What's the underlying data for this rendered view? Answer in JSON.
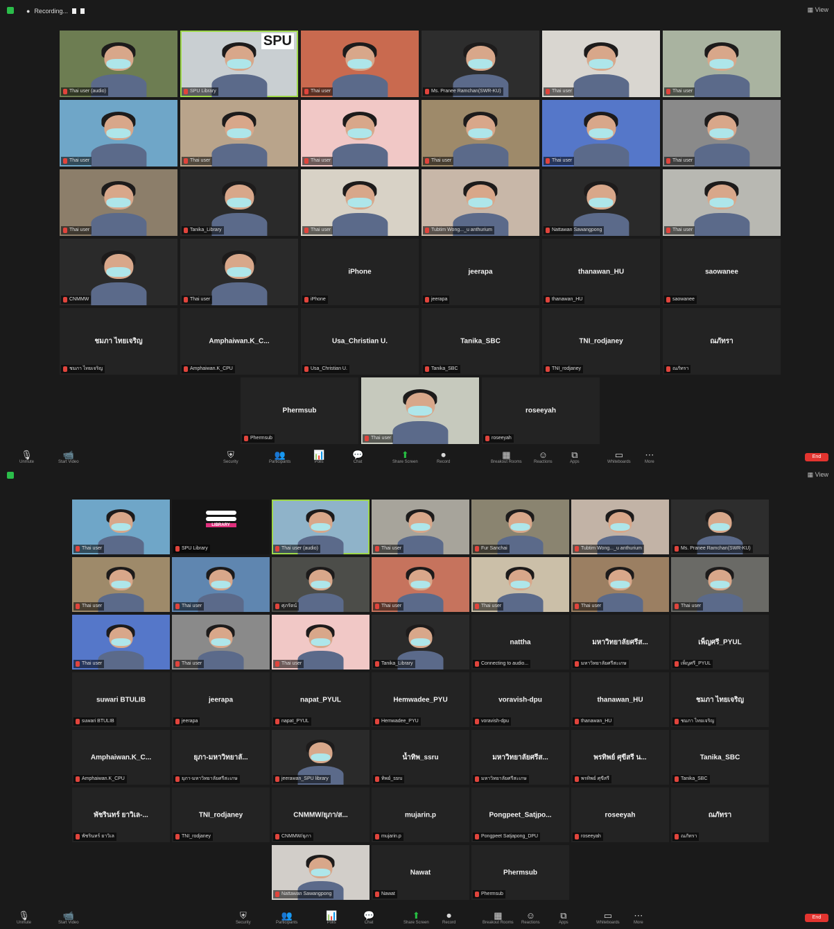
{
  "colors": {
    "background": "#1a1a1a",
    "tile": "#232323",
    "active_border": "#9ed84a",
    "end_button": "#e3342f",
    "share_green": "#27c043"
  },
  "window1": {
    "recording_label": "Recording...",
    "view_label": "View",
    "end_label": "End",
    "tiles": [
      {
        "kind": "video",
        "label": "Thai user (audio)",
        "bg": "#6d7d52"
      },
      {
        "kind": "video",
        "label": "SPU Library",
        "bg": "#c9cfd2",
        "logo": "SPU",
        "active": true
      },
      {
        "kind": "video",
        "label": "Thai user",
        "bg": "#c96a4f"
      },
      {
        "kind": "video",
        "label": "Ms. Pranee Ramchan(SWR-KU)",
        "bg": "#2d2d2d"
      },
      {
        "kind": "video",
        "label": "Thai user",
        "bg": "#d9d6d0"
      },
      {
        "kind": "video",
        "label": "Thai user",
        "bg": "#a9b3a0"
      },
      {
        "kind": "video",
        "label": "Thai user",
        "bg": "#6fa6c8"
      },
      {
        "kind": "video",
        "label": "Thai user",
        "bg": "#b9a48b"
      },
      {
        "kind": "video",
        "label": "Thai user",
        "bg": "#f1c8c6"
      },
      {
        "kind": "video",
        "label": "Thai user",
        "bg": "#9e8a6a"
      },
      {
        "kind": "video",
        "label": "Thai user",
        "bg": "#5577c9"
      },
      {
        "kind": "video",
        "label": "Thai user",
        "bg": "#8a8a8a"
      },
      {
        "kind": "video",
        "label": "Thai user",
        "bg": "#8c7e6a"
      },
      {
        "kind": "video",
        "label": "Tanika_Library",
        "bg": "#2a2a2a"
      },
      {
        "kind": "video",
        "label": "Thai user",
        "bg": "#d8d2c6"
      },
      {
        "kind": "video",
        "label": "Tubtim Wong..._u anthurium",
        "bg": "#c8b7a8"
      },
      {
        "kind": "video",
        "label": "Nattawan Sawangpong",
        "bg": "#2a2a2a"
      },
      {
        "kind": "video",
        "label": "Thai user",
        "bg": "#b8b8b2"
      },
      {
        "kind": "video",
        "label": "CNMMW",
        "bg": "#2a2a2a"
      },
      {
        "kind": "video",
        "label": "Thai user",
        "bg": "#2a2a2a"
      },
      {
        "kind": "name",
        "name": "iPhone",
        "label": "iPhone"
      },
      {
        "kind": "name",
        "name": "jeerapa",
        "label": "jeerapa"
      },
      {
        "kind": "name",
        "name": "thanawan_HU",
        "label": "thanawan_HU"
      },
      {
        "kind": "name",
        "name": "saowanee",
        "label": "saowanee"
      },
      {
        "kind": "name",
        "name": "ชมภา ไทยเจริญ",
        "label": "ชมภา ไทยเจริญ"
      },
      {
        "kind": "name",
        "name": "Amphaiwan.K_C...",
        "label": "Amphaiwan.K_CPU"
      },
      {
        "kind": "name",
        "name": "Usa_Christian U.",
        "label": "Usa_Christian U."
      },
      {
        "kind": "name",
        "name": "Tanika_SBC",
        "label": "Tanika_SBC"
      },
      {
        "kind": "name",
        "name": "TNI_rodjaney",
        "label": "TNI_rodjaney"
      },
      {
        "kind": "name",
        "name": "ณภัทรา",
        "label": "ณภัทรา"
      },
      {
        "kind": "name",
        "name": "Phermsub",
        "label": "Phermsub"
      },
      {
        "kind": "video",
        "label": "Thai user",
        "bg": "#c6c9bd"
      },
      {
        "kind": "name",
        "name": "roseeyah",
        "label": "roseeyah"
      }
    ]
  },
  "window2": {
    "view_label": "View",
    "end_label": "End",
    "tiles": [
      {
        "kind": "video",
        "label": "Thai user",
        "bg": "#6fa6c8"
      },
      {
        "kind": "video",
        "label": "SPU Library",
        "bg": "#151515",
        "logo": "LIBRARY"
      },
      {
        "kind": "video",
        "label": "Thai user (audio)",
        "bg": "#8fb3c9",
        "active": true
      },
      {
        "kind": "video",
        "label": "Thai user",
        "bg": "#a7a49b"
      },
      {
        "kind": "video",
        "label": "Fur Sanchai",
        "bg": "#8a8470"
      },
      {
        "kind": "video",
        "label": "Tubtim Wong..._u anthurium",
        "bg": "#c2b3a6"
      },
      {
        "kind": "video",
        "label": "Ms. Pranee Ramchan(SWR-KU)",
        "bg": "#2d2d2d"
      },
      {
        "kind": "video",
        "label": "Thai user",
        "bg": "#9e8a6a"
      },
      {
        "kind": "video",
        "label": "Thai user",
        "bg": "#5f86b0"
      },
      {
        "kind": "video",
        "label": "ศุภรัตน์",
        "bg": "#4c4d49"
      },
      {
        "kind": "video",
        "label": "Thai user",
        "bg": "#c6735d"
      },
      {
        "kind": "video",
        "label": "Thai user",
        "bg": "#cbbfa8"
      },
      {
        "kind": "video",
        "label": "Thai user",
        "bg": "#9b7f62"
      },
      {
        "kind": "video",
        "label": "Thai user",
        "bg": "#6a6a66"
      },
      {
        "kind": "video",
        "label": "Thai user",
        "bg": "#5577c9"
      },
      {
        "kind": "video",
        "label": "Thai user",
        "bg": "#8a8a8a"
      },
      {
        "kind": "video",
        "label": "Thai user",
        "bg": "#f1c8c6"
      },
      {
        "kind": "video",
        "label": "Tanika_Library",
        "bg": "#2a2a2a"
      },
      {
        "kind": "name",
        "name": "nattha",
        "label": "Connecting to audio..."
      },
      {
        "kind": "name",
        "name": "มหาวิทยาลัยศรีส...",
        "label": "มหาวิทยาลัยศรีสะเกษ"
      },
      {
        "kind": "name",
        "name": "เพ็ญศรี_PYUL",
        "label": "เพ็ญศรี_PYUL"
      },
      {
        "kind": "name",
        "name": "suwari BTULIB",
        "label": "suwari BTULIB"
      },
      {
        "kind": "name",
        "name": "jeerapa",
        "label": "jeerapa"
      },
      {
        "kind": "name",
        "name": "napat_PYUL",
        "label": "napat_PYUL"
      },
      {
        "kind": "name",
        "name": "Hemwadee_PYU",
        "label": "Hemwadee_PYU"
      },
      {
        "kind": "name",
        "name": "voravish-dpu",
        "label": "voravish-dpu"
      },
      {
        "kind": "name",
        "name": "thanawan_HU",
        "label": "thanawan_HU"
      },
      {
        "kind": "name",
        "name": "ชมภา ไทยเจริญ",
        "label": "ชมภา ไทยเจริญ"
      },
      {
        "kind": "name",
        "name": "Amphaiwan.K_C...",
        "label": "Amphaiwan.K_CPU"
      },
      {
        "kind": "name",
        "name": "ยุภา-มหาวิทยาลั...",
        "label": "ยุภา-มหาวิทยาลัยศรีสะเกษ"
      },
      {
        "kind": "video",
        "label": "jeerawan_SPU library",
        "bg": "#2a2a2a"
      },
      {
        "kind": "name",
        "name": "น้ำทิพ_ssru",
        "label": "ทิพย์_ssru"
      },
      {
        "kind": "name",
        "name": "มหาวิทยาลัยศรีส...",
        "label": "มหาวิทยาลัยศรีสะเกษ"
      },
      {
        "kind": "name",
        "name": "พรทิพย์ ศุขีสรี น...",
        "label": "พรทิพย์ ศุขีสรี"
      },
      {
        "kind": "name",
        "name": "Tanika_SBC",
        "label": "Tanika_SBC"
      },
      {
        "kind": "name",
        "name": "พัชรินทร์ ยาวิเล-...",
        "label": "พัชรินทร์ ยาวิเล"
      },
      {
        "kind": "name",
        "name": "TNI_rodjaney",
        "label": "TNI_rodjaney"
      },
      {
        "kind": "name",
        "name": "CNMMW/ยุภา/ส...",
        "label": "CNMMW/ยุภา"
      },
      {
        "kind": "name",
        "name": "mujarin.p",
        "label": "mujarin.p"
      },
      {
        "kind": "name",
        "name": "Pongpeet_Satjpo...",
        "label": "Pongpeet Satjapong_DPU"
      },
      {
        "kind": "name",
        "name": "roseeyah",
        "label": "roseeyah"
      },
      {
        "kind": "name",
        "name": "ณภัทรา",
        "label": "ณภัทรา"
      },
      {
        "kind": "video",
        "label": "Nattawan Sawangpong",
        "bg": "#d2cec9"
      },
      {
        "kind": "name",
        "name": "Nawat",
        "label": "Nawat"
      },
      {
        "kind": "name",
        "name": "Phermsub",
        "label": "Phermsub"
      }
    ]
  },
  "toolbar": {
    "items": [
      {
        "icon": "microphone-icon",
        "glyph": "🎙",
        "caption": "Unmute"
      },
      {
        "icon": "camera-icon",
        "glyph": "📹",
        "caption": "Start Video"
      },
      {
        "icon": "shield-icon",
        "glyph": "⛨",
        "caption": "Security"
      },
      {
        "icon": "participants-icon",
        "glyph": "👥",
        "caption": "Participants"
      },
      {
        "icon": "polls-icon",
        "glyph": "📊",
        "caption": "Polls"
      },
      {
        "icon": "chat-icon",
        "glyph": "💬",
        "caption": "Chat"
      },
      {
        "icon": "share-screen-icon",
        "glyph": "⬆",
        "caption": "Share Screen"
      },
      {
        "icon": "record-icon",
        "glyph": "⏺",
        "caption": "Record"
      },
      {
        "icon": "breakout-rooms-icon",
        "glyph": "▦",
        "caption": "Breakout Rooms"
      },
      {
        "icon": "reactions-icon",
        "glyph": "☺",
        "caption": "Reactions"
      },
      {
        "icon": "apps-icon",
        "glyph": "⧉",
        "caption": "Apps"
      },
      {
        "icon": "whiteboard-icon",
        "glyph": "▭",
        "caption": "Whiteboards"
      },
      {
        "icon": "more-icon",
        "glyph": "⋯",
        "caption": "More"
      }
    ]
  }
}
